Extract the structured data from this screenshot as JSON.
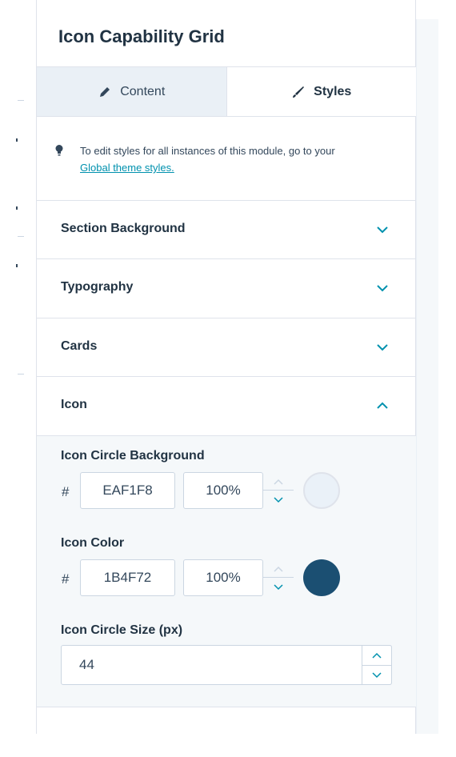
{
  "panel": {
    "title": "Icon Capability Grid"
  },
  "tabs": [
    {
      "label": "Content",
      "icon": "pencil-icon",
      "active": false
    },
    {
      "label": "Styles",
      "icon": "brush-icon",
      "active": true
    }
  ],
  "notice": {
    "icon": "lightbulb-icon",
    "text": "To edit styles for all instances of this module, go to your",
    "link": "Global theme styles."
  },
  "sections": [
    {
      "label": "Section Background",
      "expanded": false,
      "icon": "chevron-down-icon"
    },
    {
      "label": "Typography",
      "expanded": false,
      "icon": "chevron-down-icon"
    },
    {
      "label": "Cards",
      "expanded": false,
      "icon": "chevron-down-icon"
    },
    {
      "label": "Icon",
      "expanded": true,
      "icon": "chevron-up-icon"
    }
  ],
  "icon_settings": {
    "circle_background": {
      "label": "Icon Circle Background",
      "hash": "#",
      "hex": "EAF1F8",
      "opacity": "100%",
      "swatch_color": "#EAF1F8"
    },
    "icon_color": {
      "label": "Icon Color",
      "hash": "#",
      "hex": "1B4F72",
      "opacity": "100%",
      "swatch_color": "#1B4F72"
    },
    "circle_size": {
      "label": "Icon Circle Size (px)",
      "value": "44"
    }
  },
  "colors": {
    "accent_link": "#0091ae",
    "chevron": "#0091ae",
    "heading": "#213343"
  }
}
